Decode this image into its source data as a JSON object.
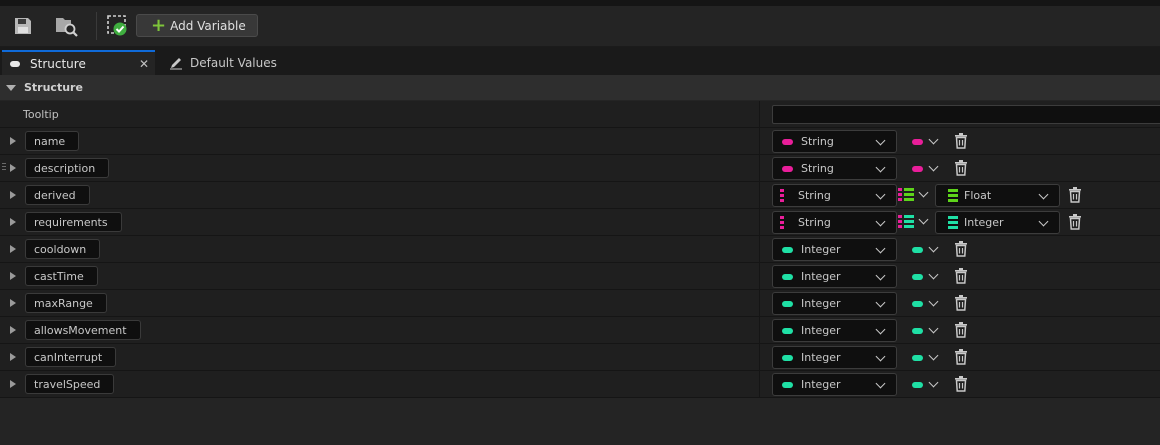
{
  "toolbar": {
    "save_icon": "save-icon",
    "browse_icon": "browse-folder-icon",
    "compile_icon": "compile-check-icon",
    "add_variable_label": "Add Variable"
  },
  "tabs": [
    {
      "label": "Structure",
      "active": true
    },
    {
      "label": "Default Values",
      "active": false
    }
  ],
  "section_title": "Structure",
  "tooltip": {
    "label": "Tooltip",
    "value": ""
  },
  "colors": {
    "string": "#e91e9a",
    "integer": "#1fe0a5",
    "float": "#5ed41b",
    "accent": "#0f6ad9",
    "add_plus": "#7ec43a"
  },
  "variables": [
    {
      "name": "name",
      "type": "String",
      "container": "single"
    },
    {
      "name": "description",
      "type": "String",
      "container": "single"
    },
    {
      "name": "derived",
      "type": "String",
      "container": "map",
      "value_type": "Float"
    },
    {
      "name": "requirements",
      "type": "String",
      "container": "map",
      "value_type": "Integer"
    },
    {
      "name": "cooldown",
      "type": "Integer",
      "container": "single"
    },
    {
      "name": "castTime",
      "type": "Integer",
      "container": "single"
    },
    {
      "name": "maxRange",
      "type": "Integer",
      "container": "single"
    },
    {
      "name": "allowsMovement",
      "type": "Integer",
      "container": "single"
    },
    {
      "name": "canInterrupt",
      "type": "Integer",
      "container": "single"
    },
    {
      "name": "travelSpeed",
      "type": "Integer",
      "container": "single"
    }
  ]
}
